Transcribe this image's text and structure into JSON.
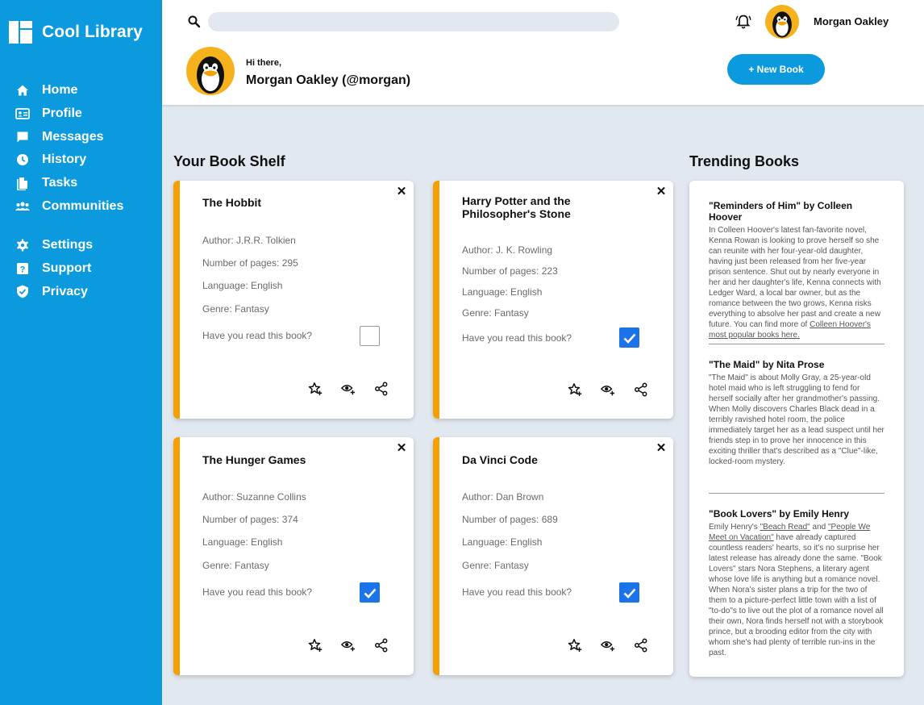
{
  "app": {
    "title": "Cool Library",
    "accent": "#0c9ade",
    "card_accent": "#f5a000",
    "checkbox_color": "#1a73e8"
  },
  "sidebar": {
    "items": [
      {
        "label": "Home",
        "icon": "home-icon"
      },
      {
        "label": "Profile",
        "icon": "profile-card-icon"
      },
      {
        "label": "Messages",
        "icon": "message-icon"
      },
      {
        "label": "History",
        "icon": "clock-icon"
      },
      {
        "label": "Tasks",
        "icon": "document-icon"
      },
      {
        "label": "Communities",
        "icon": "group-icon"
      }
    ],
    "settings_items": [
      {
        "label": "Settings",
        "icon": "gear-icon"
      },
      {
        "label": "Support",
        "icon": "question-icon"
      },
      {
        "label": "Privacy",
        "icon": "shield-check-icon"
      }
    ]
  },
  "header": {
    "search_placeholder": "",
    "user_name": "Morgan Oakley",
    "greeting": "Hi there,",
    "greeting_name": "Morgan Oakley (@morgan)",
    "new_book_label": "+ New Book"
  },
  "shelf": {
    "title": "Your Book Shelf",
    "read_question": "Have you read this book?",
    "books": [
      {
        "title": "The Hobbit",
        "author": "Author: J.R.R. Tolkien",
        "pages": "Number of pages: 295",
        "language": "Language: English",
        "genre": "Genre: Fantasy",
        "read": false
      },
      {
        "title": "Harry Potter and the Philosopher's Stone",
        "author": "Author: J. K. Rowling",
        "pages": "Number of pages: 223",
        "language": "Language: English",
        "genre": "Genre: Fantasy",
        "read": true
      },
      {
        "title": "The Hunger Games",
        "author": "Author: Suzanne Collins",
        "pages": "Number of pages: 374",
        "language": "Language: English",
        "genre": "Genre: Fantasy",
        "read": true
      },
      {
        "title": "Da Vinci Code",
        "author": "Author: Dan Brown",
        "pages": "Number of pages: 689",
        "language": "Language: English",
        "genre": "Genre: Fantasy",
        "read": true
      }
    ]
  },
  "trending": {
    "title": "Trending Books",
    "items": [
      {
        "heading": "\"Reminders of Him\" by Colleen Hoover",
        "body": "In Colleen Hoover's latest fan-favorite novel, Kenna Rowan is looking to prove herself so she can reunite with her four-year-old daughter, having just been released from her five-year prison sentence. Shut out by nearly everyone in her and her daughter's life, Kenna connects with Ledger Ward, a local bar owner, but as the romance between the two grows, Kenna risks everything to absolve her past and create a new future. You can find more of ",
        "link": "Colleen Hoover's most popular books here."
      },
      {
        "heading": "\"The Maid\" by Nita Prose",
        "body": "\"The Maid\" is about Molly Gray, a 25-year-old hotel maid who is left struggling to fend for herself socially after her grandmother's passing. When Molly discovers Charles Black dead in a terribly ravished hotel room, the police immediately target her as a lead suspect until her friends step in to prove her innocence in this exciting thriller that's described as a \"Clue\"-like, locked-room mystery."
      },
      {
        "heading": "\"Book Lovers\" by Emily Henry",
        "body_prefix": "Emily Henry's ",
        "link1": "\"Beach Read\"",
        "body_mid": " and ",
        "link2": "\"People We Meet on Vacation\"",
        "body_rest": " have already captured countless readers' hearts, so it's no surprise her latest release has already done the same. \"Book Lovers\" stars Nora Stephens, a literary agent whose love life is anything but a romance novel. When Nora's sister plans a trip for the two of them to a picture-perfect little town with a list of \"to-do\"s to live out the plot of a romance novel all their own, Nora finds herself not with a storybook prince, but a brooding editor from the city with whom she's had plenty of terrible run-ins in the past."
      }
    ]
  }
}
